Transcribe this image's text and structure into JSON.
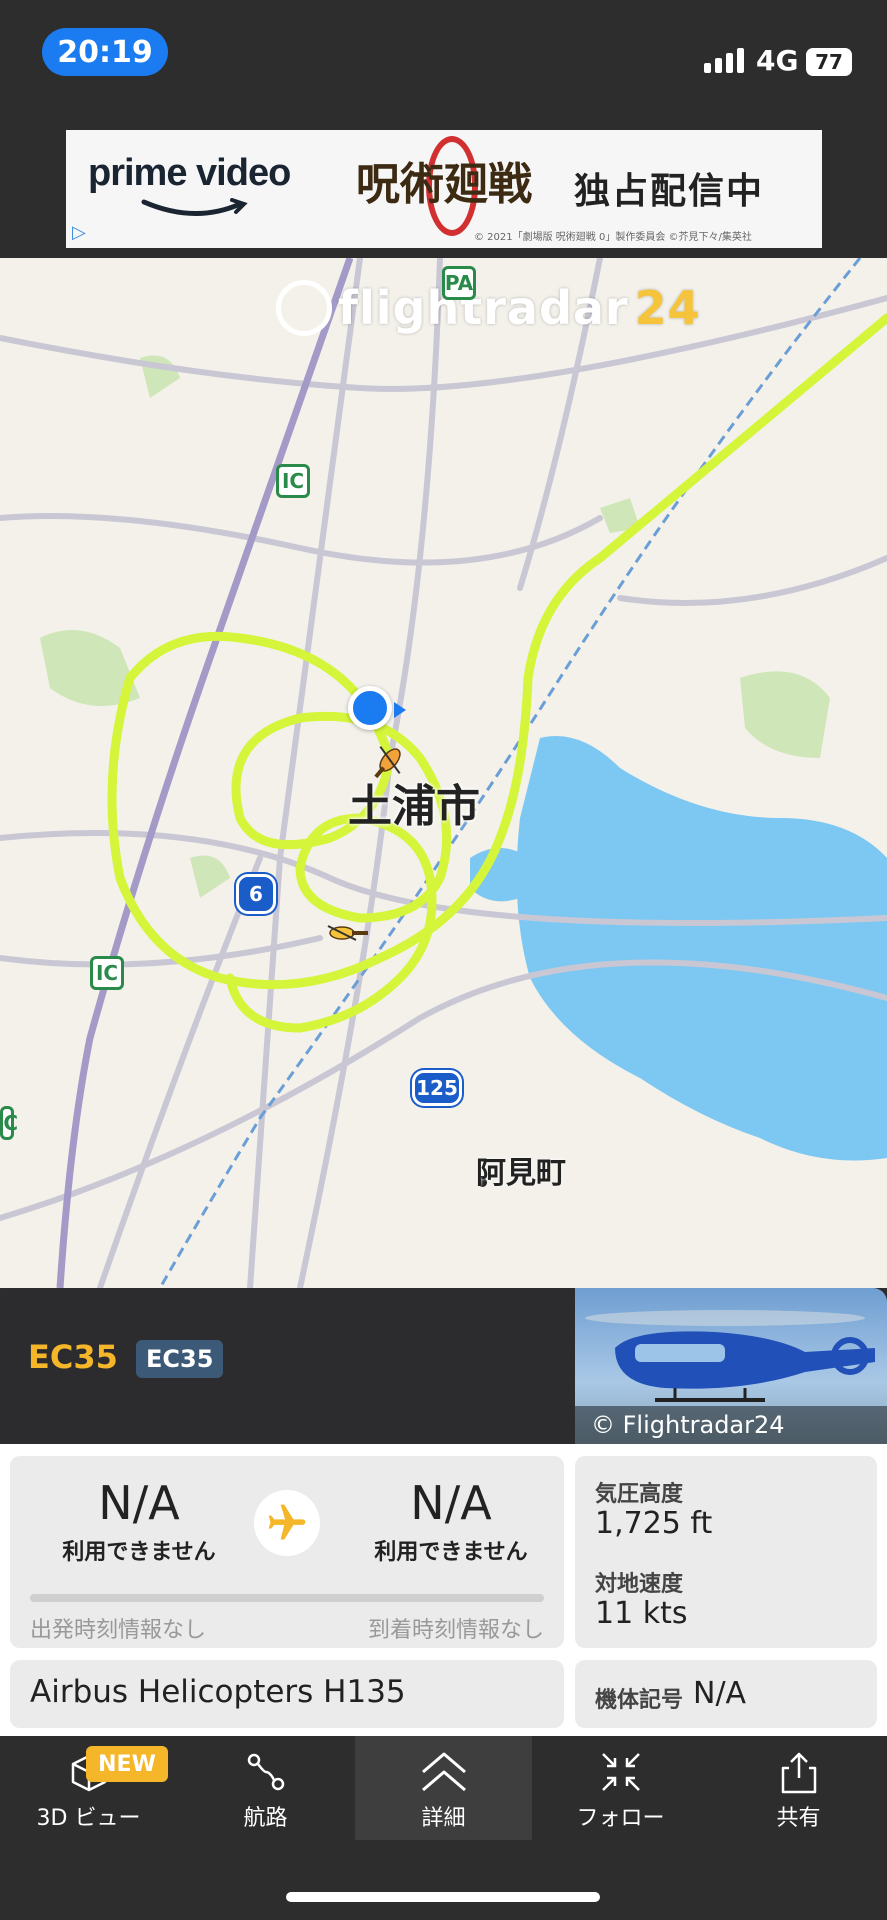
{
  "status_bar": {
    "time": "20:19",
    "network": "4G",
    "battery": "77"
  },
  "ad": {
    "brand": "prime video",
    "title": "呪術廻戦",
    "tagline": "独占配信中",
    "copyright": "© 2021「劇場版 呪術廻戦 0」製作委員会 ©芥見下々/集英社"
  },
  "map": {
    "watermark_main": "flightradar",
    "watermark_num": "24",
    "city_label": "土浦市",
    "town_label": "阿見町",
    "shields": [
      "PA",
      "IC",
      "6",
      "IC",
      "125",
      "IC"
    ],
    "track_color": "#d4f53a",
    "water_color": "#7cc8f2"
  },
  "aircraft": {
    "callsign": "EC35",
    "type_code": "EC35",
    "photo_credit": "© Flightradar24"
  },
  "route": {
    "origin_code": "N/A",
    "origin_sub": "利用できません",
    "dest_code": "N/A",
    "dest_sub": "利用できません",
    "dep_note": "出発時刻情報なし",
    "arr_note": "到着時刻情報なし"
  },
  "stats": {
    "alt_label": "気圧高度",
    "alt_value": "1,725 ft",
    "speed_label": "対地速度",
    "speed_value": "11 kts"
  },
  "model": "Airbus Helicopters H135",
  "registration": {
    "label": "機体記号",
    "value": "N/A"
  },
  "nav": {
    "new_badge": "NEW",
    "items": [
      "3D ビュー",
      "航路",
      "詳細",
      "フォロー",
      "共有"
    ]
  }
}
